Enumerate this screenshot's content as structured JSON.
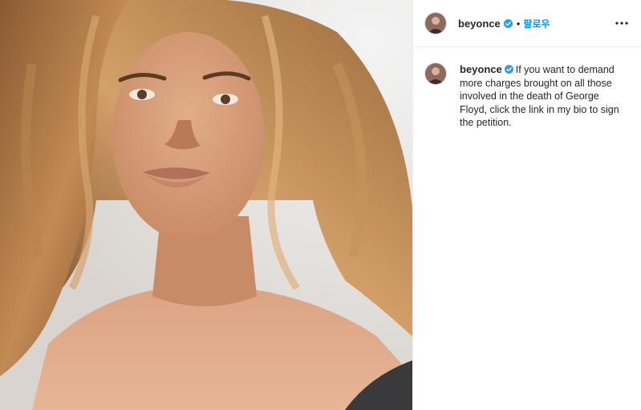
{
  "header": {
    "username": "beyonce",
    "separator": "•",
    "follow_label": "팔로우",
    "more_icon": "more-horizontal-icon"
  },
  "caption": {
    "username": "beyonce",
    "text": "If you want to demand more charges brought on all those involved in the death of George Floyd, click the link in my bio to sign the petition."
  },
  "colors": {
    "accent": "#0095f6",
    "verified": "#3897f0",
    "text": "#262626",
    "divider": "#efefef"
  }
}
